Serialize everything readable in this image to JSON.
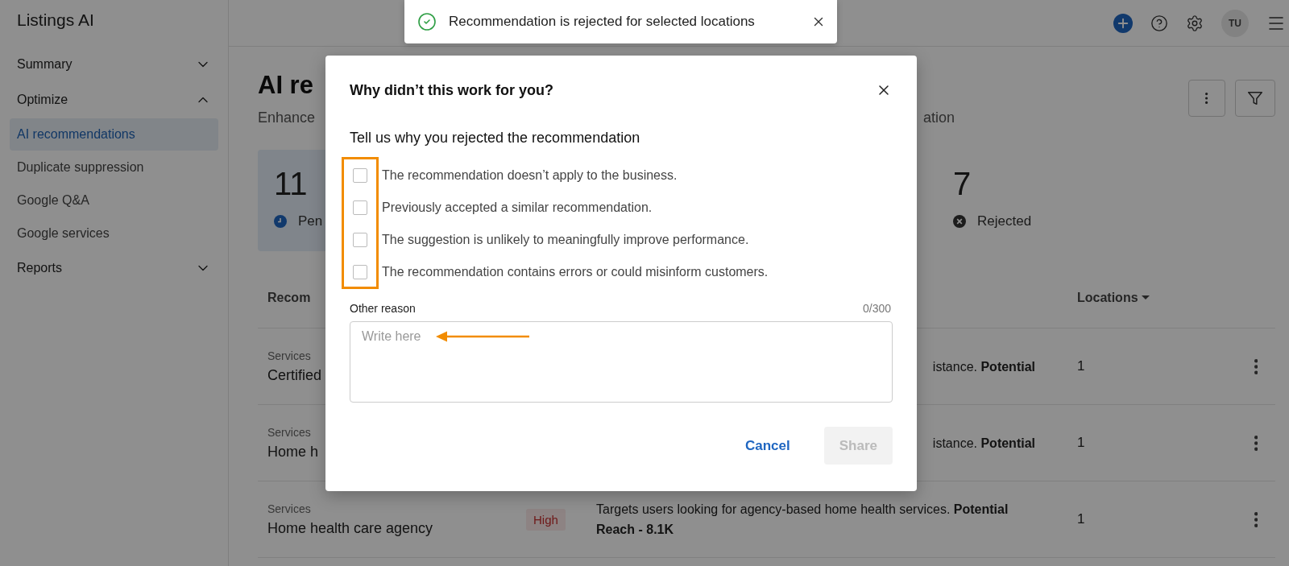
{
  "app": {
    "title": "Listings AI"
  },
  "sidebar": {
    "items": [
      {
        "label": "Summary",
        "expanded": false
      },
      {
        "label": "Optimize",
        "expanded": true,
        "children": [
          {
            "label": "AI recommendations",
            "selected": true
          },
          {
            "label": "Duplicate suppression",
            "selected": false
          },
          {
            "label": "Google Q&A",
            "selected": false
          },
          {
            "label": "Google services",
            "selected": false
          }
        ]
      },
      {
        "label": "Reports",
        "expanded": false
      }
    ]
  },
  "header": {
    "avatar": "TU"
  },
  "page": {
    "title": "AI re",
    "subtitle_left": "Enhance",
    "subtitle_right": "ation"
  },
  "stats": [
    {
      "value": "11",
      "label": "Pen",
      "kind": "pending"
    },
    {
      "value": "7",
      "label": "Rejected",
      "kind": "rejected"
    }
  ],
  "table": {
    "columns": [
      "Recom",
      "Locations"
    ],
    "rows": [
      {
        "category": "Services",
        "name": "Certified",
        "description": "istance. **Potential**",
        "clipped": true,
        "locations": "1"
      },
      {
        "category": "Services",
        "name": "Home h",
        "description": "istance. **Potential**",
        "clipped": true,
        "locations": "1"
      },
      {
        "category": "Services",
        "name": "Home health care agency",
        "priority": "High",
        "description": "Targets users looking for agency-based home health services. **Potential Reach - 8.1K**",
        "clipped": false,
        "locations": "1"
      }
    ]
  },
  "toast": {
    "message": "Recommendation is rejected for selected locations"
  },
  "dialog": {
    "title": "Why didn’t this work for you?",
    "prompt": "Tell us why you rejected the recommendation",
    "reasons": [
      {
        "label": "The recommendation doesn’t apply to the business.",
        "checked": false
      },
      {
        "label": "Previously accepted a similar recommendation.",
        "checked": false
      },
      {
        "label": "The suggestion is unlikely to meaningfully improve performance.",
        "checked": false
      },
      {
        "label": "The recommendation contains errors or could misinform customers.",
        "checked": false
      }
    ],
    "other": {
      "label": "Other reason",
      "counter": "0/300",
      "placeholder": "Write here"
    },
    "buttons": [
      {
        "label": "Cancel",
        "kind": "text",
        "disabled": false
      },
      {
        "label": "Share",
        "kind": "filled",
        "disabled": true
      }
    ]
  }
}
